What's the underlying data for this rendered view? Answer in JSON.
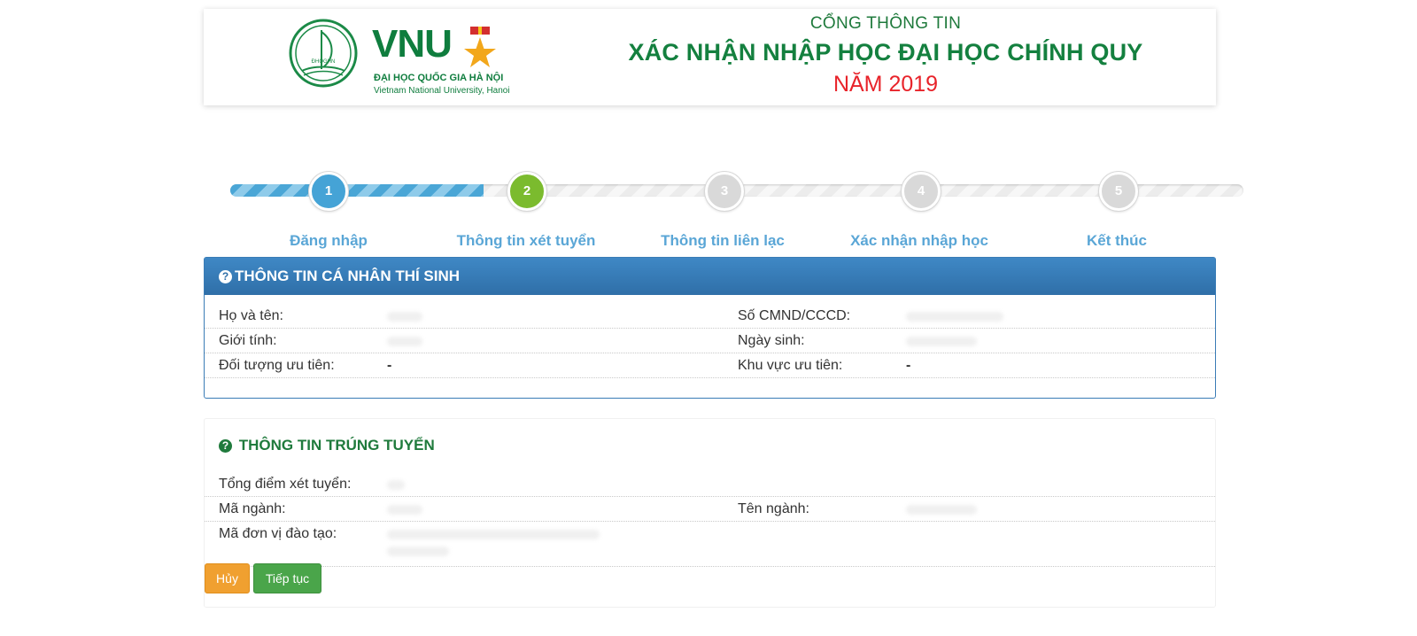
{
  "header": {
    "brand_name": "VNU",
    "seal_text": "ĐHQGHN",
    "brand_vn": "ĐẠI HỌC QUỐC GIA HÀ NỘI",
    "brand_en": "Vietnam National University, Hanoi",
    "line1": "CỔNG THÔNG TIN",
    "line2": "XÁC NHẬN NHẬP HỌC ĐẠI HỌC CHÍNH QUY",
    "line3": "NĂM 2019"
  },
  "wizard": {
    "progress_fraction": 0.25,
    "steps": [
      {
        "number": "1",
        "label": "Đăng nhập",
        "state": "done"
      },
      {
        "number": "2",
        "label": "Thông tin xét tuyển",
        "state": "active"
      },
      {
        "number": "3",
        "label": "Thông tin liên lạc",
        "state": "todo"
      },
      {
        "number": "4",
        "label": "Xác nhận nhập học",
        "state": "todo"
      },
      {
        "number": "5",
        "label": "Kết thúc",
        "state": "todo"
      }
    ]
  },
  "personal_info": {
    "title": "THÔNG TIN CÁ NHÂN THÍ SINH",
    "icon": "question-circle-icon",
    "full_name_label": "Họ và tên:",
    "id_number_label": "Số CMND/CCCD:",
    "gender_label": "Giới tính:",
    "birth_date_label": "Ngày sinh:",
    "priority_group_label": "Đối tượng ưu tiên:",
    "priority_group_value": "-",
    "priority_area_label": "Khu vực ưu tiên:",
    "priority_area_value": "-"
  },
  "admission_info": {
    "title": "THÔNG TIN TRÚNG TUYỂN",
    "icon": "question-circle-icon",
    "total_score_label": "Tổng điểm xét tuyển:",
    "major_code_label": "Mã ngành:",
    "major_name_label": "Tên ngành:",
    "unit_code_label": "Mã đơn vị đào tạo:"
  },
  "actions": {
    "cancel_label": "Hủy",
    "next_label": "Tiếp tục"
  },
  "colors": {
    "brand_green": "#14803f",
    "year_red": "#e8232a",
    "step_done": "#45a3d6",
    "step_active": "#7bbb2e",
    "panel_header_blue": "#2f6fa8",
    "cancel_orange": "#f0a030",
    "next_green": "#4aa54a"
  }
}
